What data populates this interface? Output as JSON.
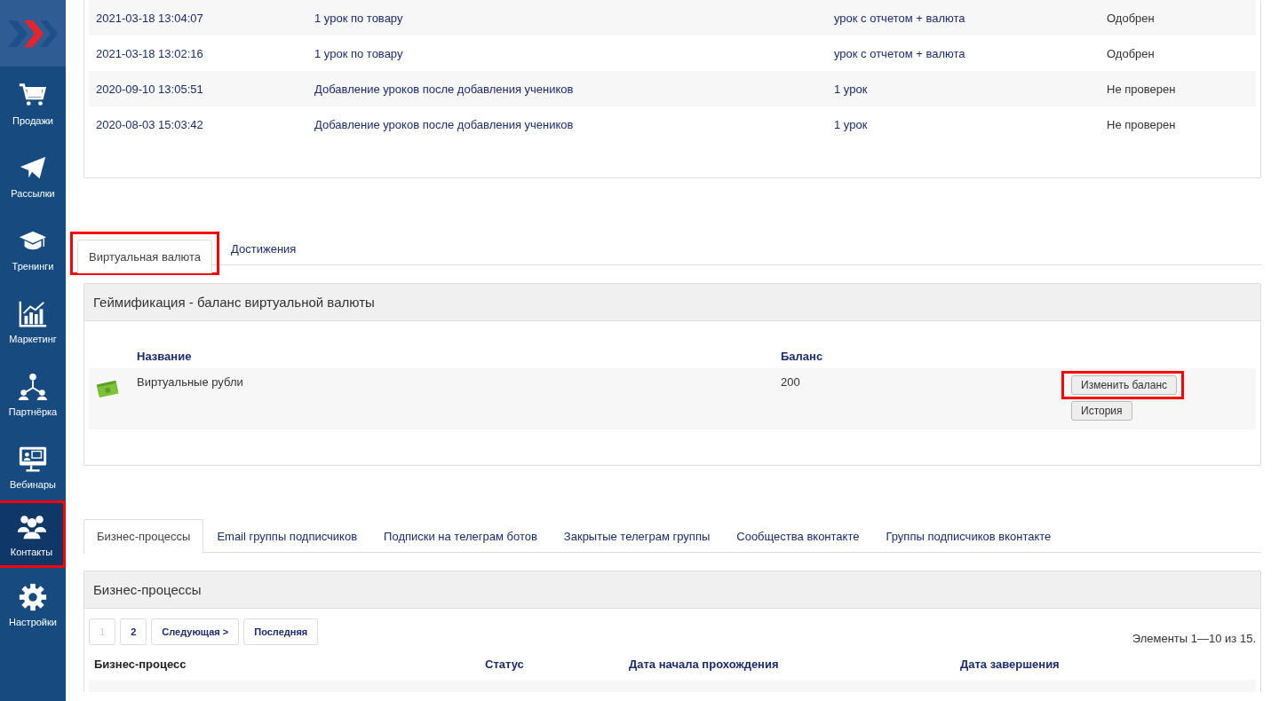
{
  "sidebar": {
    "items": [
      {
        "label": "Продажи",
        "selected": false,
        "highlighted": false
      },
      {
        "label": "Рассылки",
        "selected": false,
        "highlighted": false
      },
      {
        "label": "Тренинги",
        "selected": false,
        "highlighted": false
      },
      {
        "label": "Маркетинг",
        "selected": false,
        "highlighted": false
      },
      {
        "label": "Партнёрка",
        "selected": false,
        "highlighted": false
      },
      {
        "label": "Вебинары",
        "selected": false,
        "highlighted": false
      },
      {
        "label": "Контакты",
        "selected": true,
        "highlighted": true
      },
      {
        "label": "Настройки",
        "selected": false,
        "highlighted": false
      }
    ]
  },
  "history": {
    "rows": [
      [
        "2021-03-18 13:04:07",
        "1 урок по товару",
        "урок с отчетом + валюта",
        "Одобрен"
      ],
      [
        "2021-03-18 13:02:16",
        "1 урок по товару",
        "урок с отчетом + валюта",
        "Одобрен"
      ],
      [
        "2020-09-10 13:05:51",
        "Добавление уроков после добавления учеников",
        "1 урок",
        "Не проверен"
      ],
      [
        "2020-08-03 15:03:42",
        "Добавление уроков после добавления учеников",
        "1 урок",
        "Не проверен"
      ]
    ]
  },
  "currency_tabs": [
    {
      "label": "Виртуальная валюта",
      "selected": true,
      "highlighted": true
    },
    {
      "label": "Достижения",
      "selected": false,
      "highlighted": false
    }
  ],
  "gamification": {
    "title": "Геймификация - баланс виртуальной валюты",
    "columns": [
      "Название",
      "Баланс"
    ],
    "rows": [
      {
        "name": "Виртуальные рубли",
        "balance": "200",
        "buttons": [
          {
            "label": "Изменить баланс",
            "highlighted": true
          },
          {
            "label": "История",
            "highlighted": false
          }
        ]
      }
    ]
  },
  "process_tabs": [
    {
      "label": "Бизнес-процессы",
      "selected": true
    },
    {
      "label": "Email группы подписчиков",
      "selected": false
    },
    {
      "label": "Подписки на телеграм ботов",
      "selected": false
    },
    {
      "label": "Закрытые телеграм группы",
      "selected": false
    },
    {
      "label": "Сообщества вконтакте",
      "selected": false
    },
    {
      "label": "Группы подписчиков вконтакте",
      "selected": false
    }
  ],
  "processes": {
    "title": "Бизнес-процессы",
    "pagination": [
      {
        "label": "1",
        "disabled": true
      },
      {
        "label": "2",
        "disabled": false
      },
      {
        "label": "Следующая >",
        "disabled": false
      },
      {
        "label": "Последняя",
        "disabled": false
      }
    ],
    "count": "Элементы 1—10 из 15.",
    "columns": [
      {
        "label": "Бизнес-процесс",
        "link": false
      },
      {
        "label": "Статус",
        "link": true
      },
      {
        "label": "Дата начала прохождения",
        "link": true
      },
      {
        "label": "Дата завершения",
        "link": true
      }
    ]
  }
}
